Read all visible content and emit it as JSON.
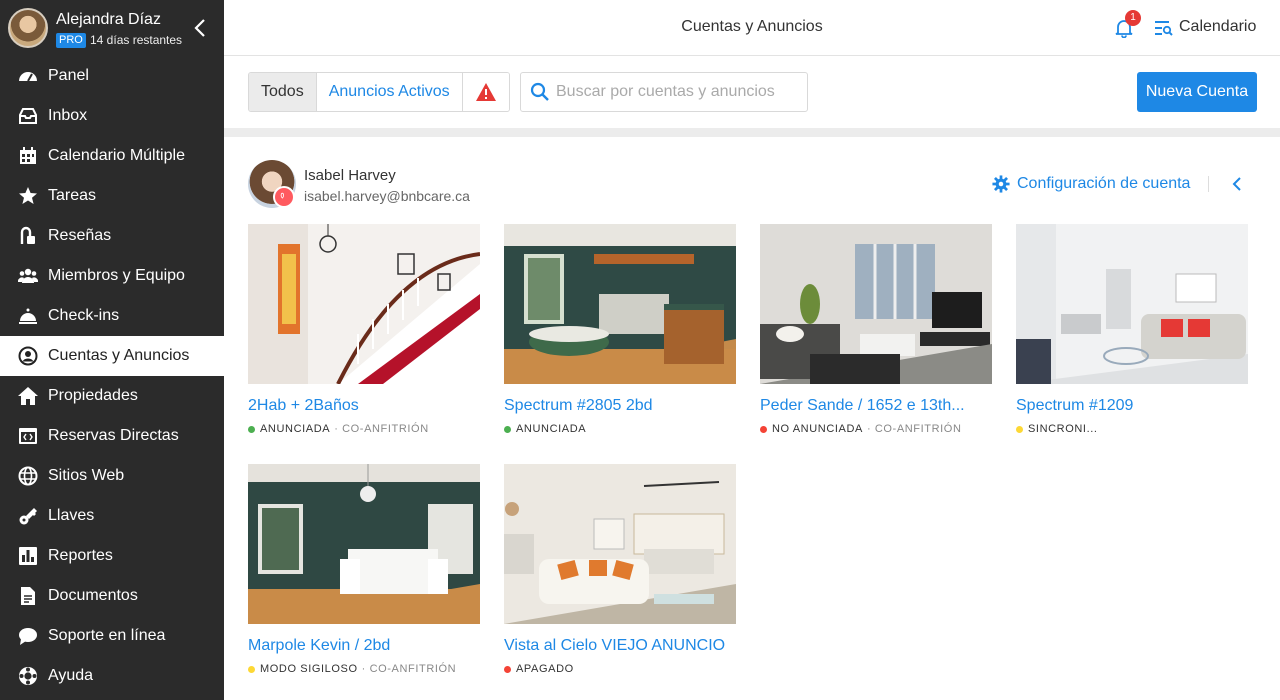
{
  "user": {
    "name": "Alejandra Díaz",
    "plan": "PRO",
    "trial": "14 días restantes"
  },
  "nav": [
    {
      "label": "Panel",
      "icon": "gauge-icon"
    },
    {
      "label": "Inbox",
      "icon": "inbox-icon"
    },
    {
      "label": "Calendario Múltiple",
      "icon": "calendar-icon"
    },
    {
      "label": "Tareas",
      "icon": "star-icon"
    },
    {
      "label": "Reseñas",
      "icon": "review-icon"
    },
    {
      "label": "Miembros y Equipo",
      "icon": "team-icon"
    },
    {
      "label": "Check-ins",
      "icon": "bell-service-icon"
    },
    {
      "label": "Cuentas y Anuncios",
      "icon": "account-circle-icon",
      "active": true
    },
    {
      "label": "Propiedades",
      "icon": "home-icon"
    },
    {
      "label": "Reservas Directas",
      "icon": "browser-code-icon"
    },
    {
      "label": "Sitios Web",
      "icon": "globe-icon"
    },
    {
      "label": "Llaves",
      "icon": "key-icon"
    },
    {
      "label": "Reportes",
      "icon": "chart-icon"
    },
    {
      "label": "Documentos",
      "icon": "document-icon"
    },
    {
      "label": "Soporte en línea",
      "icon": "chat-icon"
    },
    {
      "label": "Ayuda",
      "icon": "lifebuoy-icon"
    }
  ],
  "header": {
    "title": "Cuentas y Anuncios",
    "notifications": "1",
    "calendar": "Calendario"
  },
  "toolbar": {
    "filters": [
      "Todos",
      "Anuncios Activos"
    ],
    "search_placeholder": "Buscar por cuentas y anuncios",
    "new_account": "Nueva Cuenta"
  },
  "account": {
    "name": "Isabel Harvey",
    "email": "isabel.harvey@bnbcare.ca",
    "config": "Configuración de cuenta"
  },
  "listings": [
    {
      "title": "2Hab + 2Baños",
      "status": "ANUNCIADA",
      "role": "· CO-ANFITRIÓN",
      "color": "#4caf50"
    },
    {
      "title": "Spectrum #2805 2bd",
      "status": "ANUNCIADA",
      "role": "",
      "color": "#4caf50"
    },
    {
      "title": "Peder Sande / 1652 e 13th...",
      "status": "NO ANUNCIADA",
      "role": "· CO-ANFITRIÓN",
      "color": "#f44336"
    },
    {
      "title": "Spectrum #1209",
      "status": "SINCRONI...",
      "role": "",
      "color": "#fdd835"
    },
    {
      "title": "Marpole Kevin / 2bd",
      "status": "MODO SIGILOSO",
      "role": "· CO-ANFITRIÓN",
      "color": "#fdd835"
    },
    {
      "title": "Vista al Cielo VIEJO ANUNCIO",
      "status": "APAGADO",
      "role": "",
      "color": "#f44336"
    }
  ]
}
